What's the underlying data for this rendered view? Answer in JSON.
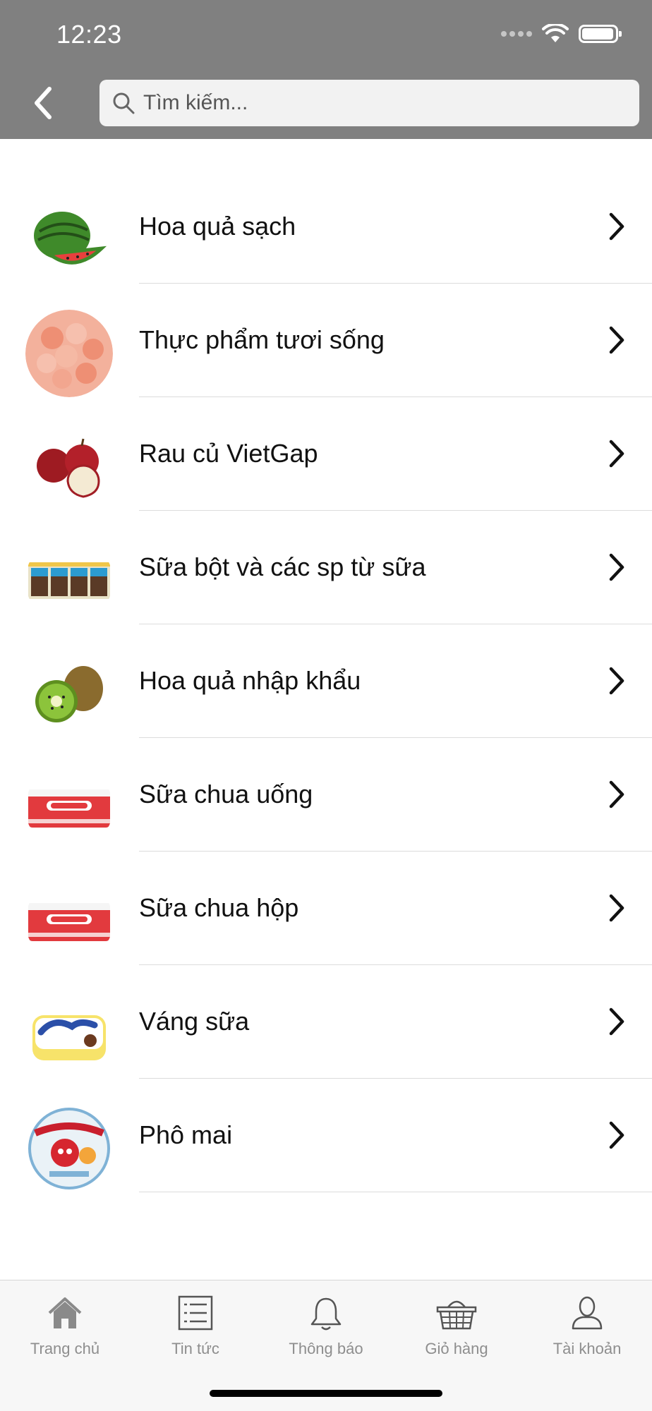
{
  "status_bar": {
    "time": "12:23"
  },
  "header": {
    "back_icon": "chevron-left-icon",
    "search": {
      "placeholder": "Tìm kiếm...",
      "value": "",
      "icon": "search-icon"
    }
  },
  "categories": [
    {
      "label": "Hoa quả sạch",
      "image": "watermelon-image"
    },
    {
      "label": "Thực phẩm tươi sống",
      "image": "shrimp-image"
    },
    {
      "label": "Rau củ VietGap",
      "image": "apples-image"
    },
    {
      "label": "Sữa bột và các sp từ sữa",
      "image": "milk-boxes-image"
    },
    {
      "label": "Hoa quả nhập khẩu",
      "image": "kiwi-image"
    },
    {
      "label": "Sữa chua uống",
      "image": "betagen-bottles-image"
    },
    {
      "label": "Sữa chua hộp",
      "image": "betagen-bottles-image"
    },
    {
      "label": "Váng sữa",
      "image": "monte-dessert-image"
    },
    {
      "label": "Phô mai",
      "image": "laughing-cow-cheese-image"
    }
  ],
  "tabbar": {
    "items": [
      {
        "label": "Trang chủ",
        "icon": "home-icon"
      },
      {
        "label": "Tin tức",
        "icon": "news-list-icon"
      },
      {
        "label": "Thông báo",
        "icon": "bell-icon"
      },
      {
        "label": "Giỏ hàng",
        "icon": "basket-icon"
      },
      {
        "label": "Tài khoản",
        "icon": "account-icon"
      }
    ]
  },
  "colors": {
    "header_bg": "#808080",
    "search_bg": "#f2f2f2",
    "tab_label": "#8e8e8e"
  }
}
